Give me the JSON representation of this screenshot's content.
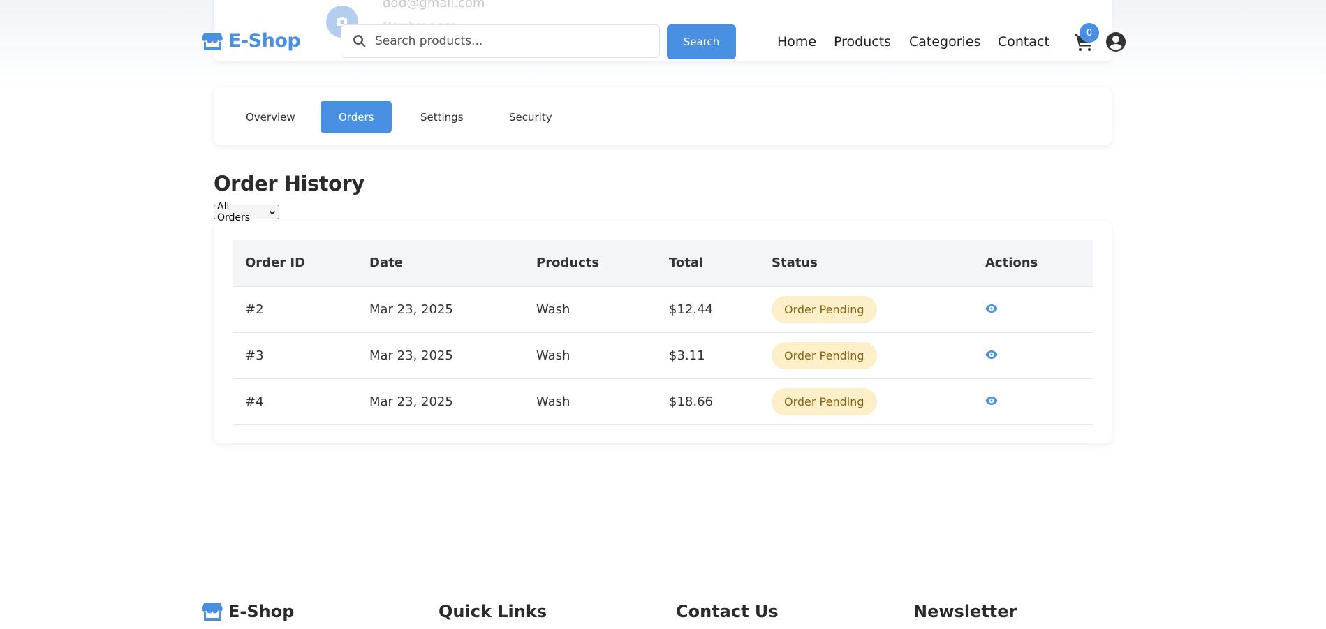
{
  "profile": {
    "email": "ddd@gmail.com",
    "sub": "Member since"
  },
  "header": {
    "logo": "E-Shop",
    "search_placeholder": "Search products...",
    "search_button": "Search",
    "nav": [
      "Home",
      "Products",
      "Categories",
      "Contact"
    ],
    "cart_count": "0"
  },
  "tabs": [
    {
      "label": "Overview",
      "active": false
    },
    {
      "label": "Orders",
      "active": true
    },
    {
      "label": "Settings",
      "active": false
    },
    {
      "label": "Security",
      "active": false
    }
  ],
  "orders": {
    "title": "Order History",
    "filter": "All Orders",
    "columns": [
      "Order ID",
      "Date",
      "Products",
      "Total",
      "Status",
      "Actions"
    ],
    "rows": [
      {
        "id": "#2",
        "date": "Mar 23, 2025",
        "products": "Wash",
        "total": "$12.44",
        "status": "Order Pending"
      },
      {
        "id": "#3",
        "date": "Mar 23, 2025",
        "products": "Wash",
        "total": "$3.11",
        "status": "Order Pending"
      },
      {
        "id": "#4",
        "date": "Mar 23, 2025",
        "products": "Wash",
        "total": "$18.66",
        "status": "Order Pending"
      }
    ]
  },
  "footer": {
    "logo": "E-Shop",
    "quick_links": "Quick Links",
    "contact": "Contact Us",
    "newsletter": "Newsletter"
  },
  "colors": {
    "accent": "#4a90e2",
    "badge_bg": "#fdf0c8",
    "badge_text": "#8a6416"
  }
}
